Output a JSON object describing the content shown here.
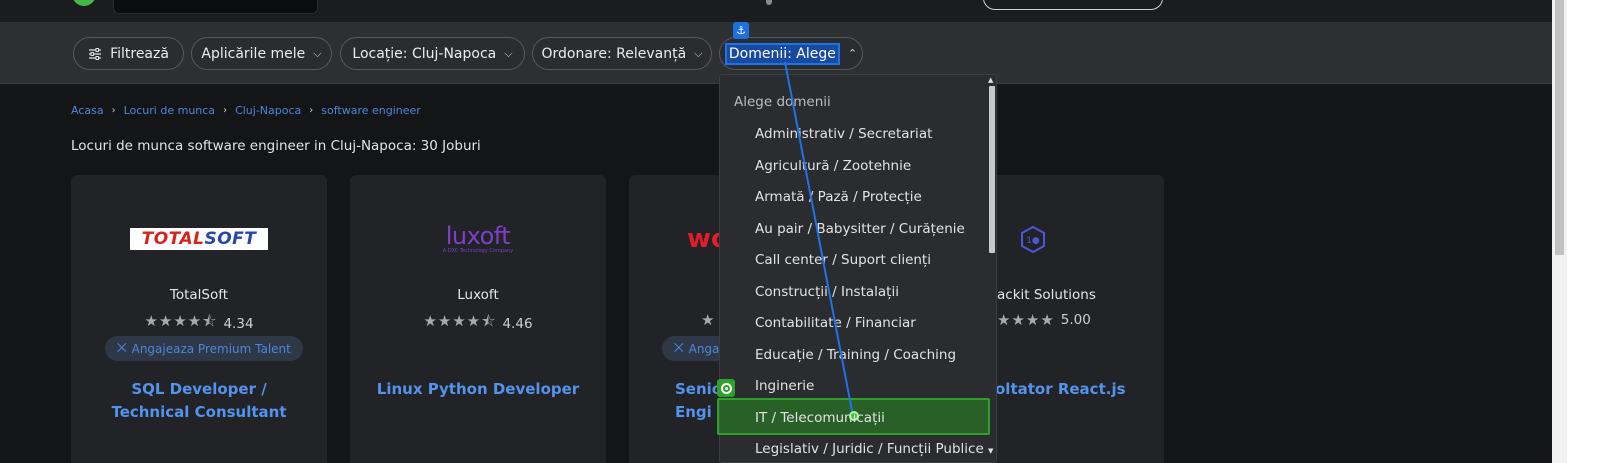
{
  "filters": {
    "filter_label": "Filtrează",
    "apps_label": "Aplicările mele",
    "location_label": "Locație: Cluj-Napoca",
    "order_label": "Ordonare: Relevanță",
    "domains_label": "Domenii: Alege"
  },
  "breadcrumb": [
    "Acasa",
    "Locuri de munca",
    "Cluj-Napoca",
    "software engineer"
  ],
  "heading": "Locuri de munca software engineer in Cluj-Napoca: 30 Joburi",
  "cards": [
    {
      "logo_text_a": "TOTAL",
      "logo_text_b": "SOFT",
      "company": "TotalSoft",
      "rating": "4.34",
      "badge": "Angajeaza Premium Talent",
      "title": "SQL Developer / Technical Consultant"
    },
    {
      "logo_text_a": "luxoft",
      "logo_text_b": "A DXC Technology Company",
      "company": "Luxoft",
      "rating": "4.46",
      "badge": "",
      "title": "Linux Python Developer"
    },
    {
      "logo_text_a": "wo",
      "company": "",
      "rating": "",
      "badge": "Anga",
      "title": "Senio Engi"
    },
    {
      "company": "ackit Solutions",
      "rating": "5.00",
      "title": "oltator React.js"
    }
  ],
  "dropdown": {
    "header": "Alege domenii",
    "options": [
      "Administrativ / Secretariat",
      "Agricultură / Zootehnie",
      "Armată / Pază / Protecție",
      "Au pair / Babysitter / Curățenie",
      "Call center / Suport clienți",
      "Construcții / Instalații",
      "Contabilitate / Financiar",
      "Educație / Training / Coaching",
      "Inginerie",
      "IT / Telecomunicații",
      "Legislativ / Juridic / Funcții Publice"
    ],
    "highlighted_index": 9
  },
  "icons": {
    "anchor": "⚓",
    "star": "★",
    "half_star": "⯪",
    "chevron_down": "⌵",
    "chevron_up": "⌃",
    "medal": "🏅"
  },
  "colors": {
    "accent_link": "#5393ec",
    "highlight_green": "#2fa12a",
    "highlight_blue": "#1e73e8"
  }
}
